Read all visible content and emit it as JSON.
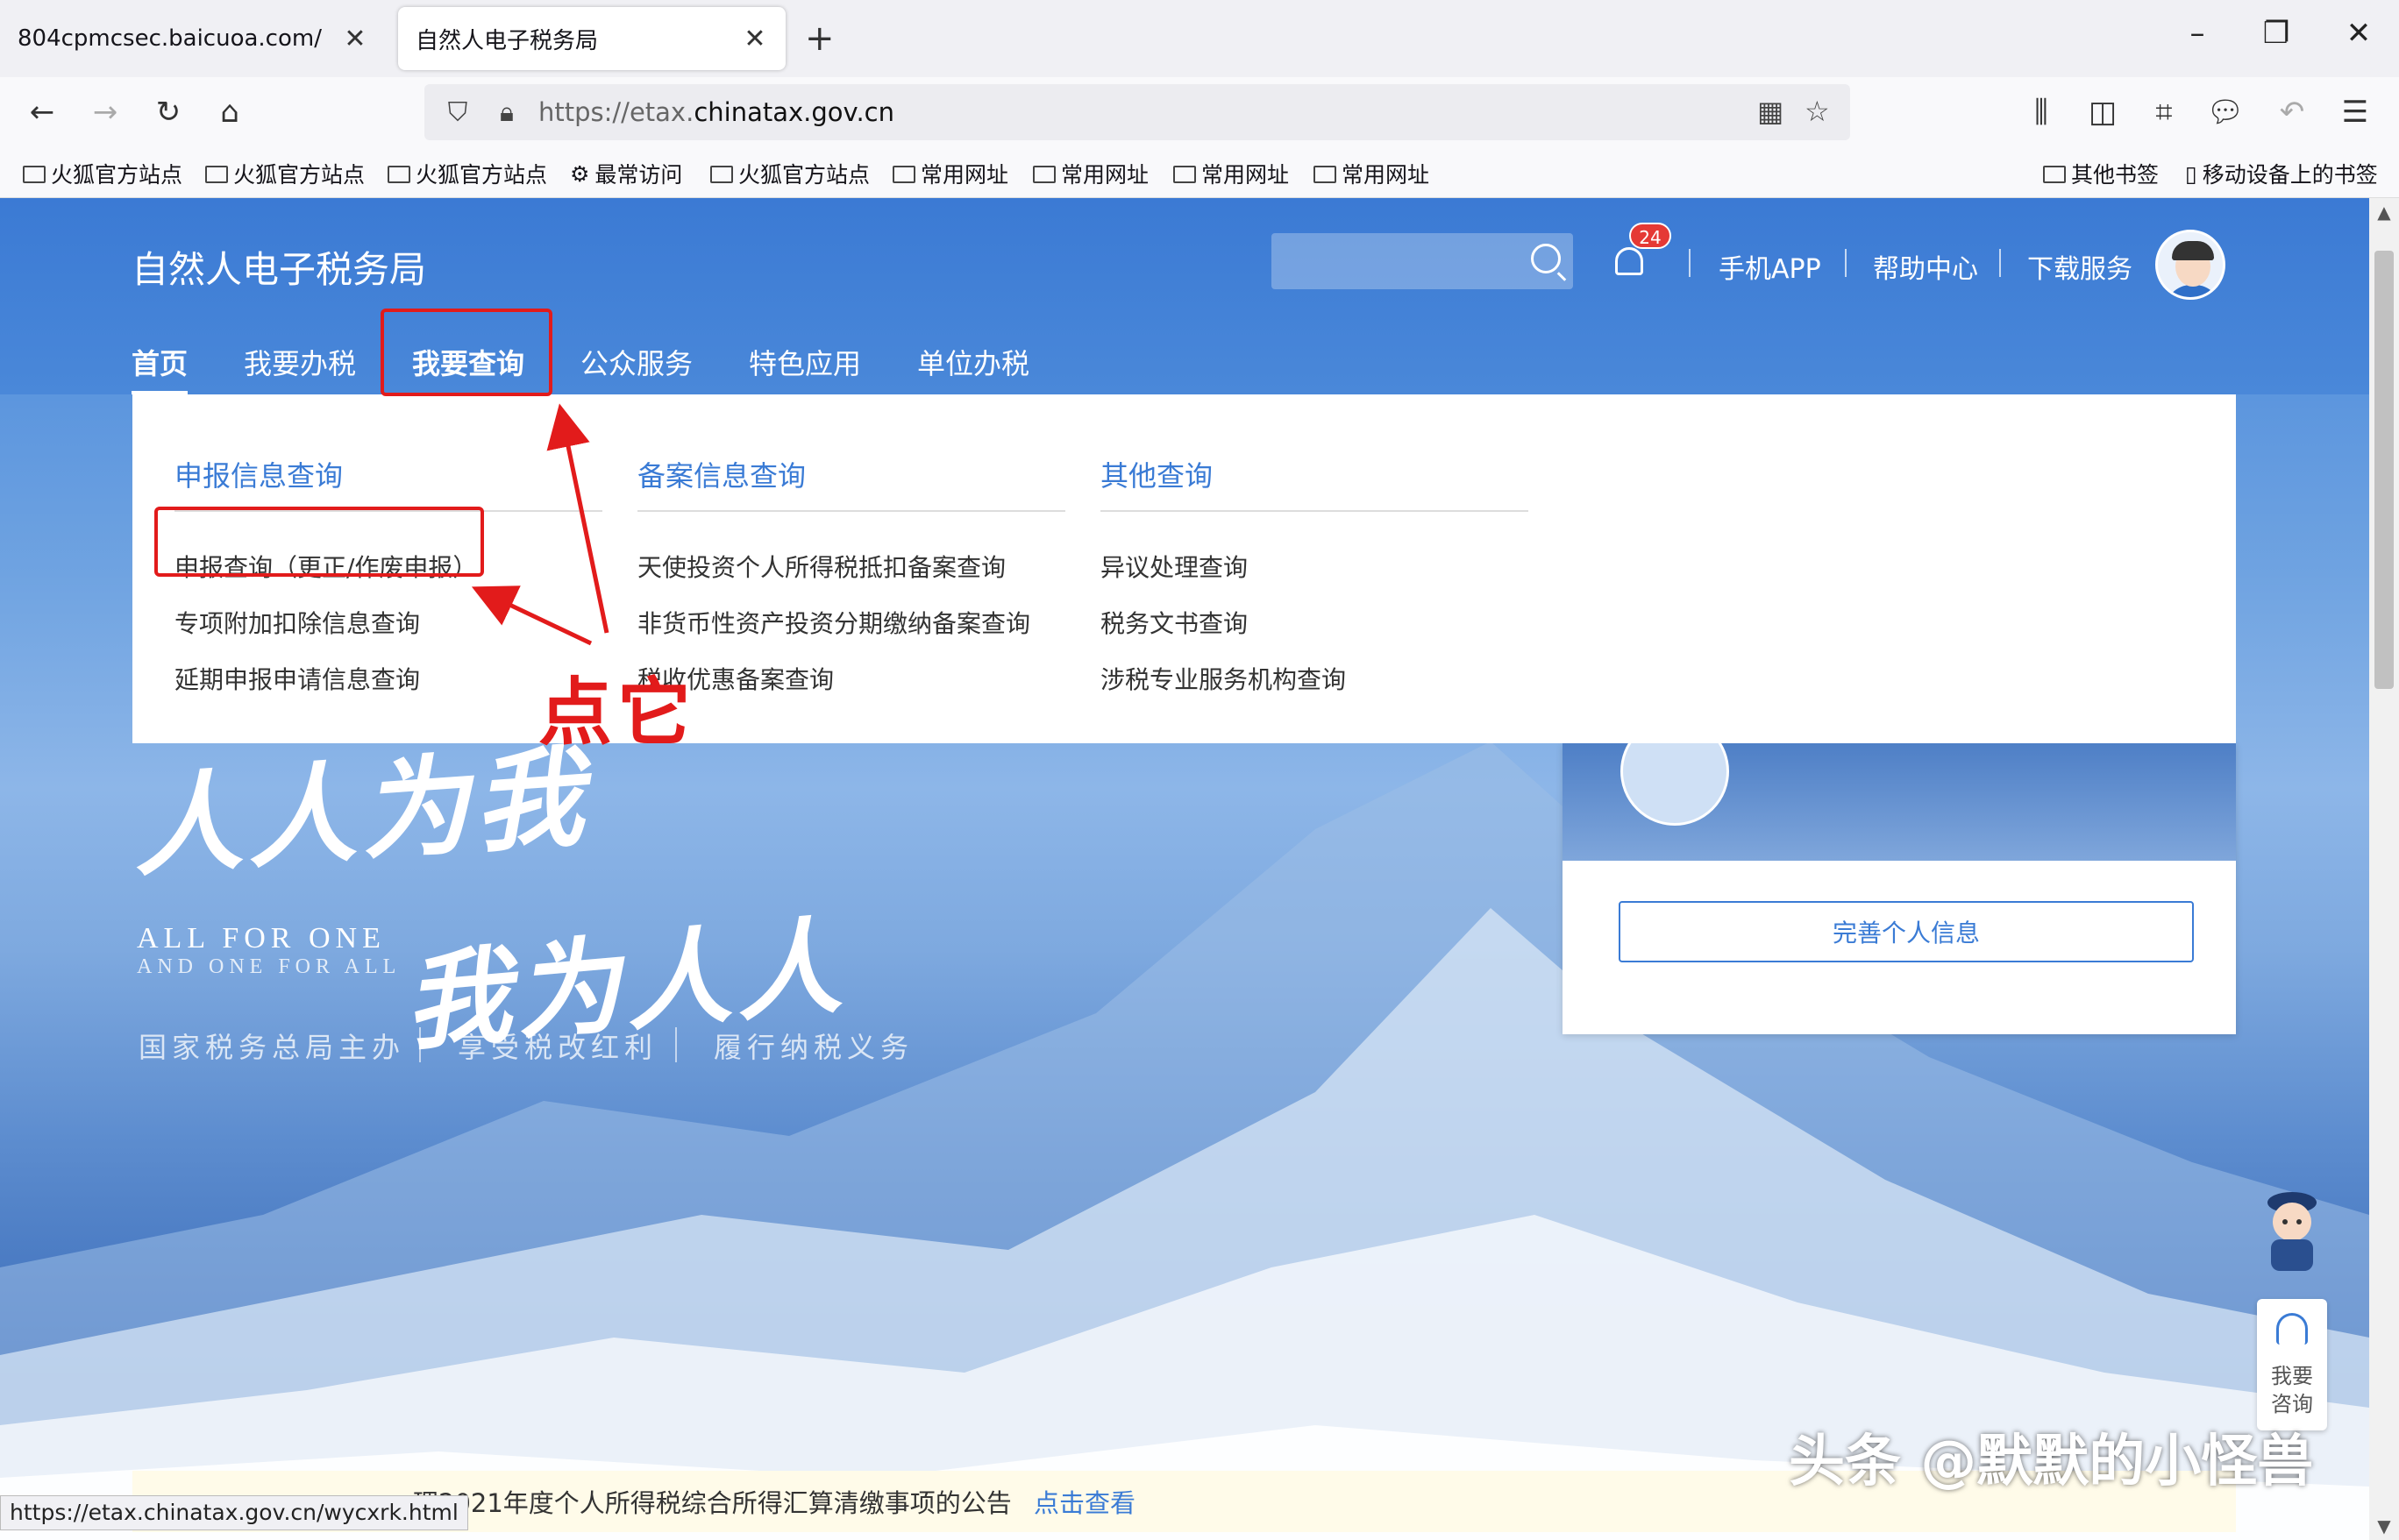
{
  "browser": {
    "tabs": [
      {
        "title": "804cpmcsec.baicuoa.com/",
        "active": false
      },
      {
        "title": "自然人电子税务局",
        "active": true
      }
    ],
    "url_prefix": "https://etax.",
    "url_domain": "chinatax.gov.cn",
    "bookmarks": [
      "火狐官方站点",
      "火狐官方站点",
      "火狐官方站点",
      "最常访问",
      "火狐官方站点",
      "常用网址",
      "常用网址",
      "常用网址",
      "常用网址"
    ],
    "bookmarks_right": [
      "其他书签",
      "移动设备上的书签"
    ],
    "status_url": "https://etax.chinatax.gov.cn/wycxrk.html"
  },
  "site": {
    "title": "自然人电子税务局",
    "search_placeholder": "",
    "notification_count": "24",
    "header_links": [
      "手机APP",
      "帮助中心",
      "下载服务"
    ],
    "nav": [
      "首页",
      "我要办税",
      "我要查询",
      "公众服务",
      "特色应用",
      "单位办税"
    ]
  },
  "dropdown": {
    "columns": [
      {
        "heading": "申报信息查询",
        "items": [
          "申报查询（更正/作废申报）",
          "专项附加扣除信息查询",
          "延期申报申请信息查询"
        ]
      },
      {
        "heading": "备案信息查询",
        "items": [
          "天使投资个人所得税抵扣备案查询",
          "非货币性资产投资分期缴纳备案查询",
          "税收优惠备案查询"
        ]
      },
      {
        "heading": "其他查询",
        "items": [
          "异议处理查询",
          "税务文书查询",
          "涉税专业服务机构查询"
        ]
      }
    ]
  },
  "annotation": {
    "text": "点它"
  },
  "hero": {
    "slogan_line1": "人人为我",
    "slogan_line2": "我为人人",
    "english_line1": "ALL FOR ONE",
    "english_line2": "AND ONE FOR ALL",
    "taglines": [
      "国家税务总局主办",
      "享受税改红利",
      "履行纳税义务"
    ]
  },
  "login_card": {
    "button": "完善个人信息"
  },
  "consult": {
    "label_line1": "我要",
    "label_line2": "咨询"
  },
  "notice": {
    "text": "理2021年度个人所得税综合所得汇算清缴事项的公告",
    "link": "点击查看"
  },
  "watermark": "头条 @默默的小怪兽",
  "colors": {
    "brand_blue": "#3a7bd5",
    "annotation_red": "#e21b1b",
    "badge_red": "#e53935"
  }
}
